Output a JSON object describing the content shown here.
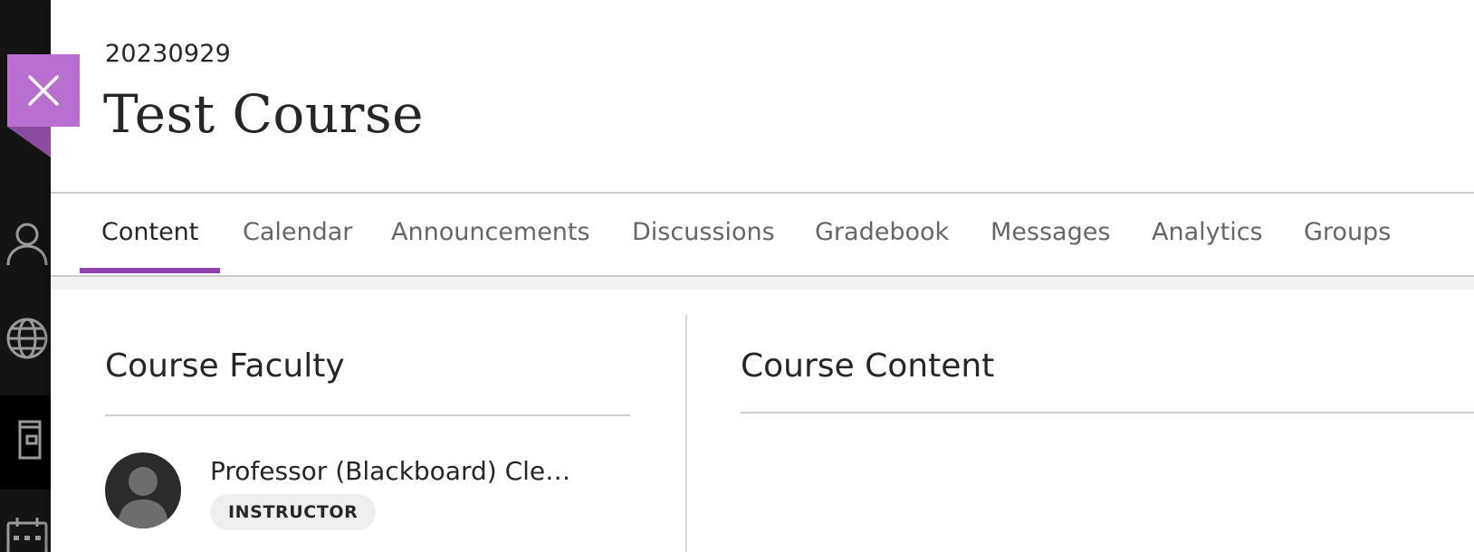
{
  "header": {
    "course_code": "20230929",
    "course_title": "Test Course"
  },
  "close_button": {
    "icon": "close-icon"
  },
  "rail": {
    "icons": [
      "user-icon",
      "globe-icon",
      "courses-icon",
      "calendar-icon"
    ],
    "active": "courses-icon"
  },
  "tabs": [
    {
      "label": "Content",
      "active": true
    },
    {
      "label": "Calendar",
      "active": false
    },
    {
      "label": "Announcements",
      "active": false
    },
    {
      "label": "Discussions",
      "active": false
    },
    {
      "label": "Gradebook",
      "active": false
    },
    {
      "label": "Messages",
      "active": false
    },
    {
      "label": "Analytics",
      "active": false
    },
    {
      "label": "Groups",
      "active": false
    }
  ],
  "faculty": {
    "heading": "Course Faculty",
    "members": [
      {
        "name": "Professor (Blackboard) Clem...",
        "role": "INSTRUCTOR"
      }
    ]
  },
  "content": {
    "heading": "Course Content"
  },
  "colors": {
    "accent": "#8e43b0",
    "close_tab": "#b96fd0",
    "rail": "#141414"
  }
}
